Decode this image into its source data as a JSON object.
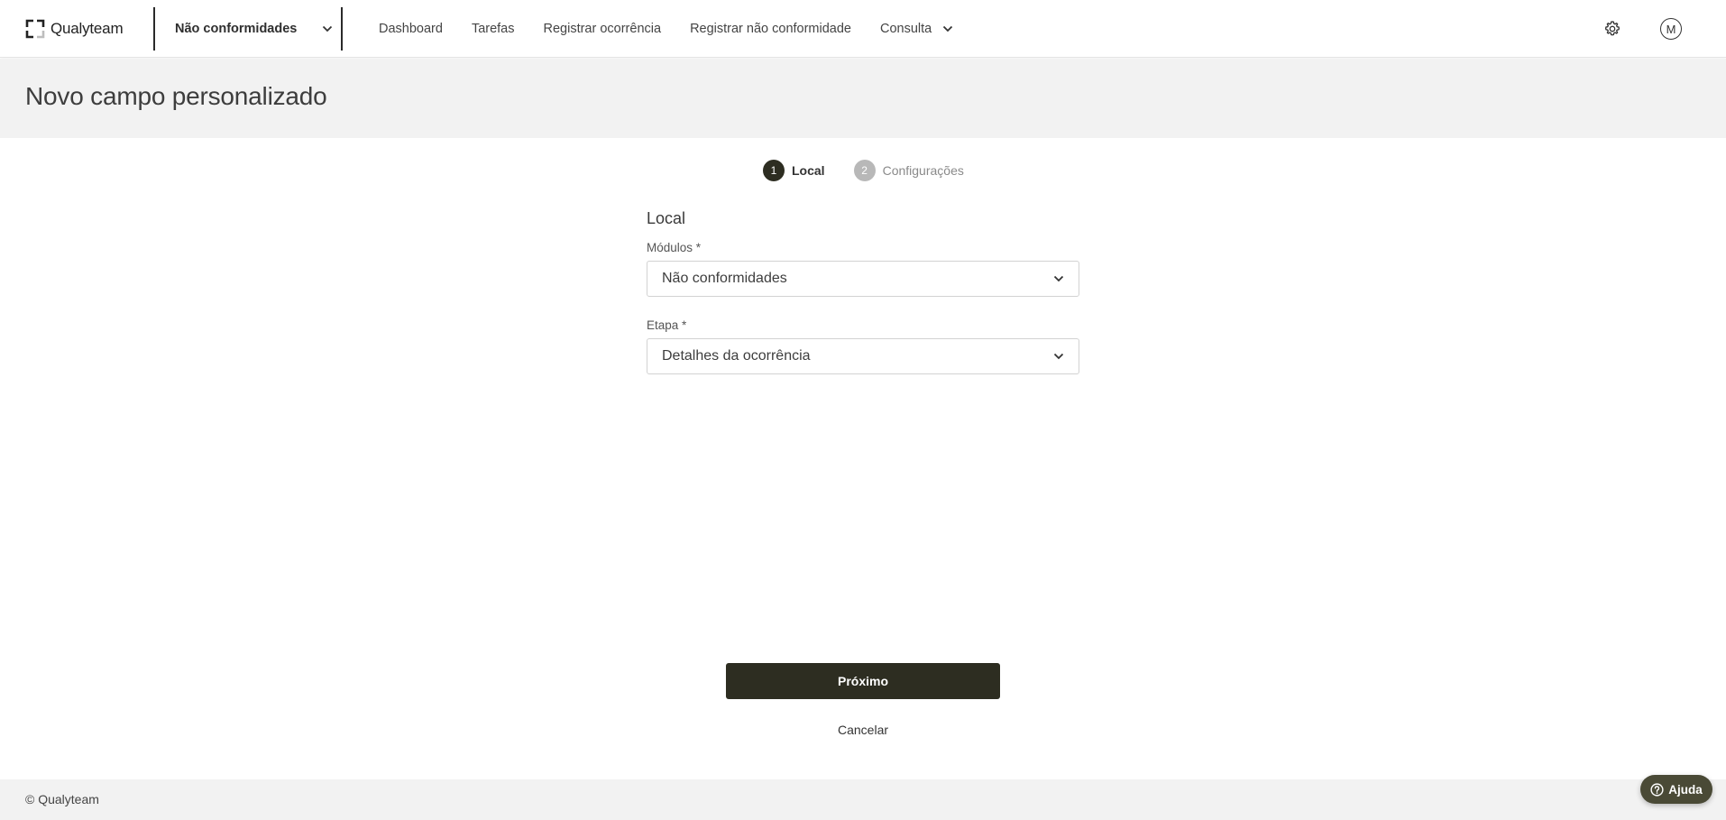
{
  "brand": {
    "name": "Qualyteam"
  },
  "module_selector": {
    "value": "Não conformidades",
    "icon": "chevron-down-icon"
  },
  "nav": {
    "items": [
      {
        "label": "Dashboard"
      },
      {
        "label": "Tarefas"
      },
      {
        "label": "Registrar ocorrência"
      },
      {
        "label": "Registrar não conformidade"
      },
      {
        "label": "Consulta",
        "icon": "chevron-down-icon"
      }
    ]
  },
  "user": {
    "initial": "M"
  },
  "page": {
    "title": "Novo campo personalizado"
  },
  "stepper": {
    "steps": [
      {
        "number": "1",
        "label": "Local",
        "state": "active"
      },
      {
        "number": "2",
        "label": "Configurações",
        "state": "inactive"
      }
    ]
  },
  "form": {
    "section_title": "Local",
    "fields": [
      {
        "label": "Módulos *",
        "value": "Não conformidades"
      },
      {
        "label": "Etapa *",
        "value": "Detalhes da ocorrência"
      }
    ]
  },
  "actions": {
    "next_label": "Próximo",
    "cancel_label": "Cancelar"
  },
  "footer": {
    "copyright": "© Qualyteam"
  },
  "help": {
    "label": "Ajuda"
  },
  "colors": {
    "primary": "#2d2d21",
    "header_band": "#f2f2f2",
    "help_button": "#4a4a36",
    "step_inactive": "#b8b8b8"
  }
}
